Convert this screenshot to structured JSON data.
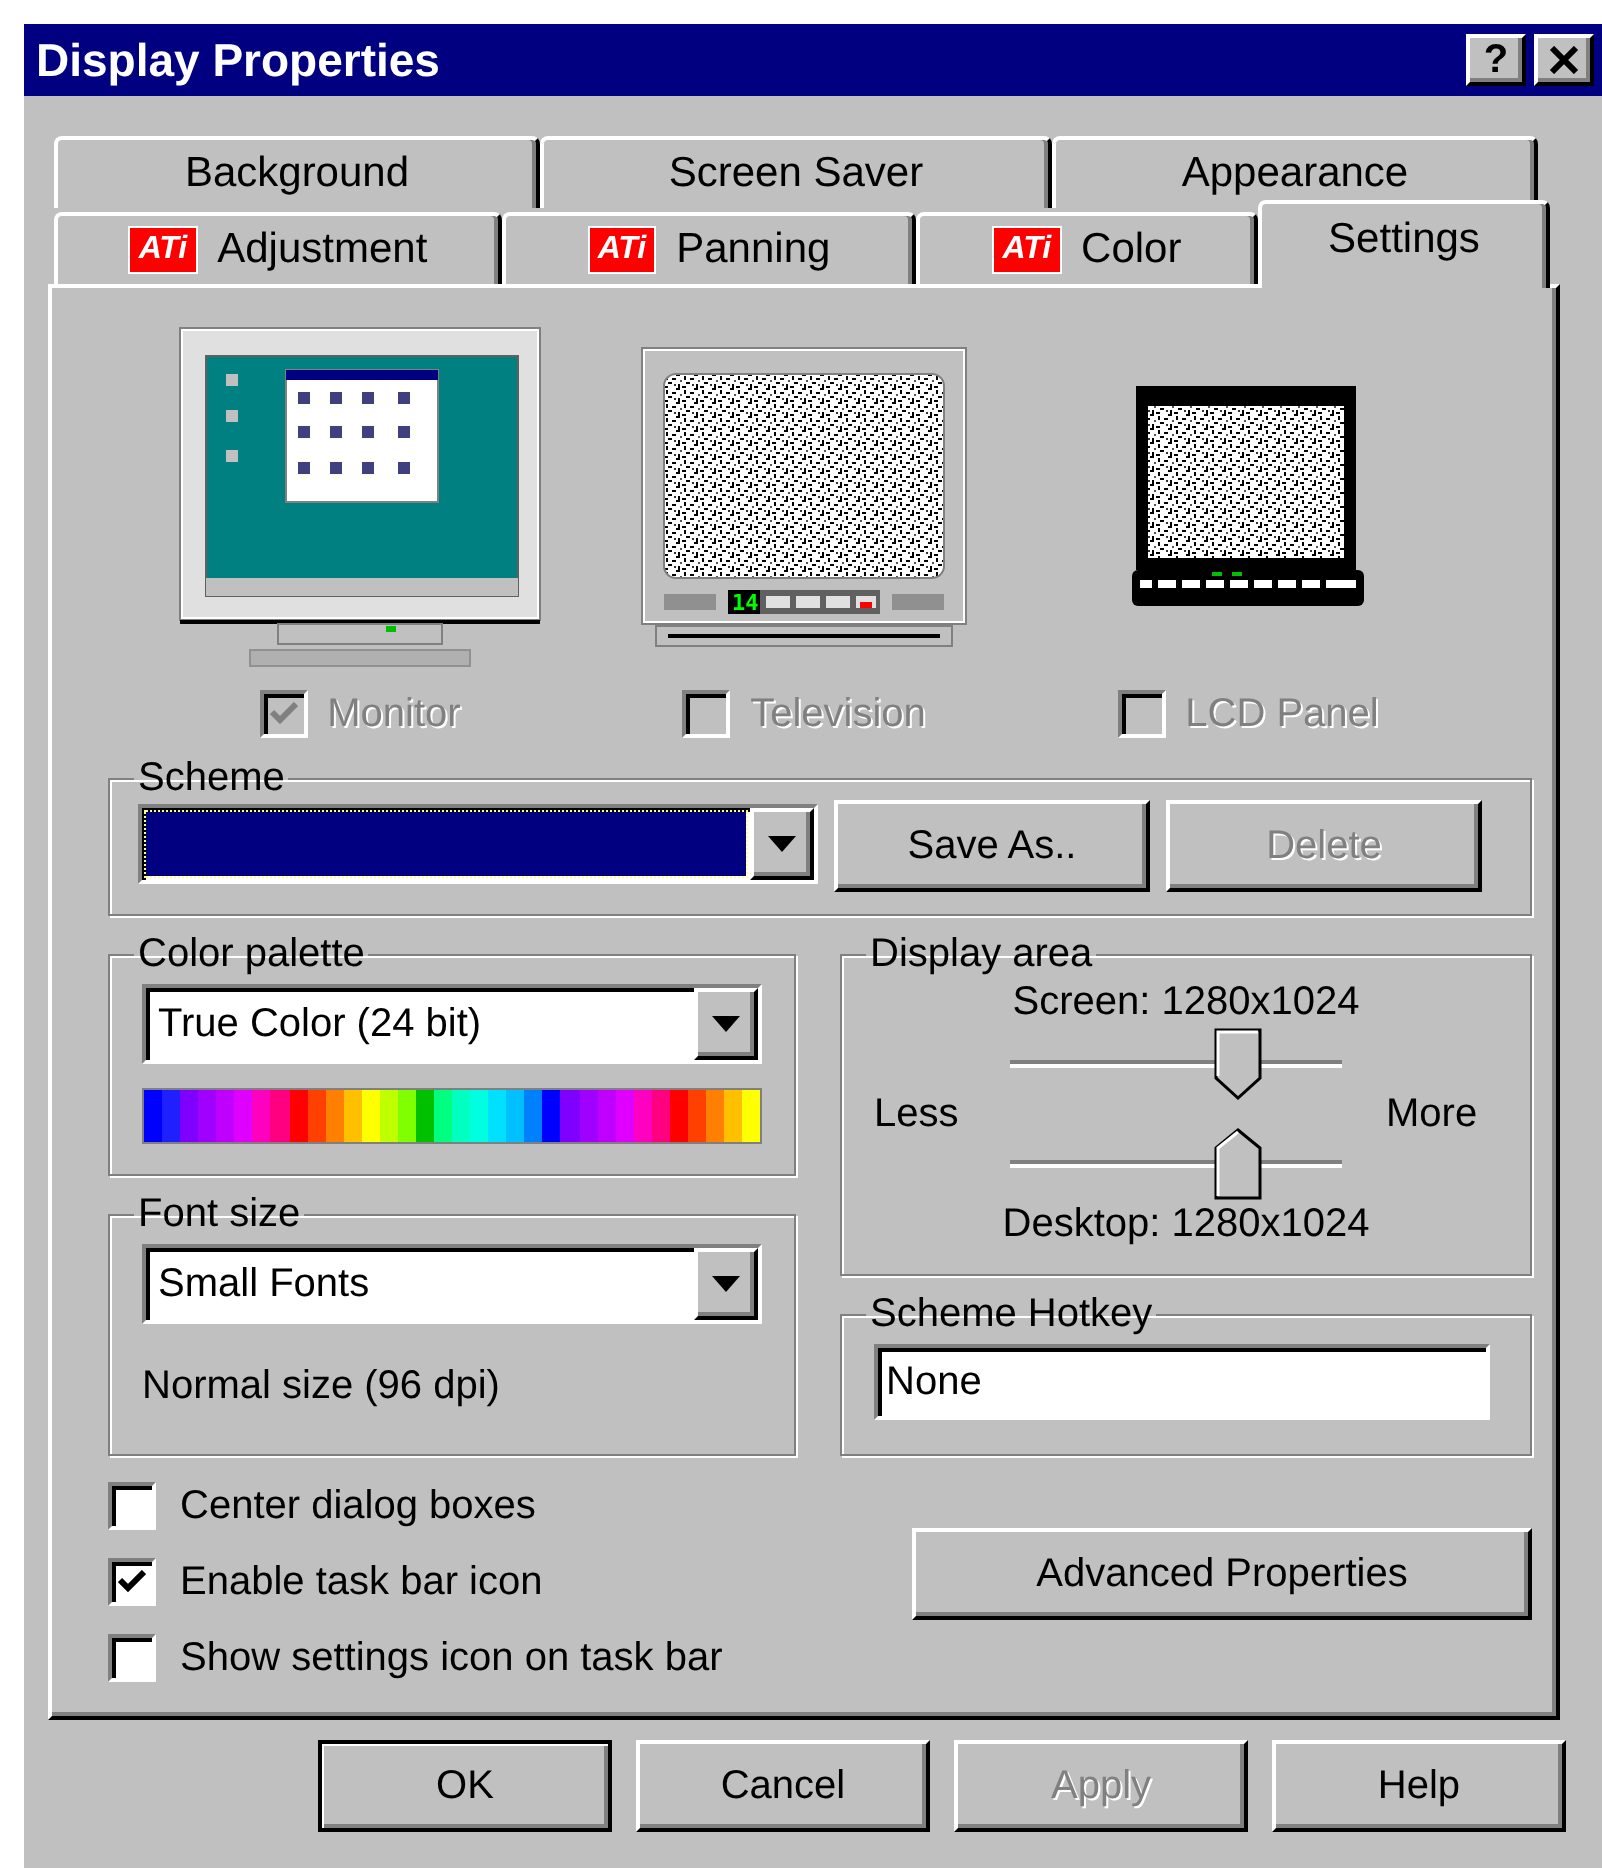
{
  "window": {
    "title": "Display Properties",
    "help_button": "?"
  },
  "tab_rows": [
    [
      {
        "label": "Background",
        "selected": false
      },
      {
        "label": "Screen Saver",
        "selected": false
      },
      {
        "label": "Appearance",
        "selected": false
      }
    ],
    [
      {
        "label": "Adjustment",
        "selected": false,
        "logo": "ATi"
      },
      {
        "label": "Panning",
        "selected": false,
        "logo": "ATi"
      },
      {
        "label": "Color",
        "selected": false,
        "logo": "ATi"
      },
      {
        "label": "Settings",
        "selected": true
      }
    ]
  ],
  "devices": [
    {
      "kind": "monitor",
      "label": "Monitor",
      "checked": true,
      "disabled": true
    },
    {
      "kind": "television",
      "label": "Television",
      "checked": false,
      "disabled": true,
      "channel": "14"
    },
    {
      "kind": "lcd",
      "label": "LCD Panel",
      "checked": false,
      "disabled": true
    }
  ],
  "scheme": {
    "label": "Scheme",
    "buttons": [
      {
        "label": "Save As..",
        "disabled": false
      },
      {
        "label": "Delete",
        "disabled": true
      }
    ]
  },
  "color_palette": {
    "label": "Color palette",
    "value": "True Color (24 bit)"
  },
  "font_size": {
    "label": "Font size",
    "value": "Small Fonts",
    "note": "Normal size (96 dpi)"
  },
  "display_area": {
    "label": "Display area",
    "screen_label": "Screen: 1280x1024",
    "less": "Less",
    "more": "More",
    "desktop_label": "Desktop: 1280x1024",
    "sliders": [
      {
        "kind": "screen",
        "level": 0.72
      },
      {
        "kind": "desktop",
        "level": 0.72
      }
    ]
  },
  "scheme_hotkey": {
    "label": "Scheme Hotkey",
    "value": "None"
  },
  "options": [
    {
      "label": "Center dialog boxes",
      "checked": false
    },
    {
      "label": "Enable task bar icon",
      "checked": true
    },
    {
      "label": "Show settings icon on task bar",
      "checked": false
    }
  ],
  "advanced_button": {
    "label": "Advanced Properties"
  },
  "buttons": [
    {
      "label": "OK",
      "default": true,
      "disabled": false
    },
    {
      "label": "Cancel",
      "default": false,
      "disabled": false
    },
    {
      "label": "Apply",
      "default": false,
      "disabled": true
    },
    {
      "label": "Help",
      "default": false,
      "disabled": false
    }
  ]
}
